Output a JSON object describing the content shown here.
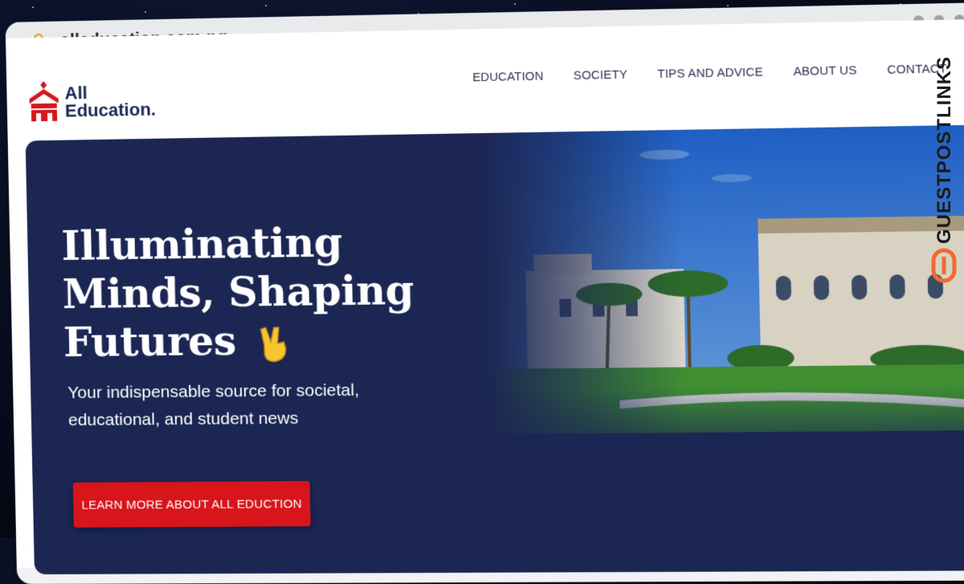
{
  "browser": {
    "url": "alleducation.com.ng",
    "lock_icon": "lock-icon",
    "window_dots": [
      "dot",
      "dot",
      "dot"
    ]
  },
  "site": {
    "logo": {
      "line1": "All",
      "line2": "Education",
      "dot": ".",
      "icon": "school-building-icon"
    },
    "nav": [
      "EDUCATION",
      "SOCIETY",
      "TIPS AND ADVICE",
      "ABOUT US",
      "CONTACT"
    ]
  },
  "hero": {
    "title_line1": "Illuminating",
    "title_line2": "Minds, Shaping",
    "title_line3": "Futures",
    "emoji": "victory-hand-emoji",
    "subtitle": "Your indispensable source for societal, educational, and student news",
    "cta": "LEARN MORE ABOUT ALL EDUCTION",
    "image": "university-campus-photo"
  },
  "watermark": {
    "text": "GUESTPOSTLINKS",
    "icon": "guestpostlinks-logo-icon"
  },
  "colors": {
    "hero_bg": "#1b2653",
    "accent_red": "#d8151b",
    "watermark_orange": "#ef6b2c",
    "nav_text": "#2a3150"
  }
}
